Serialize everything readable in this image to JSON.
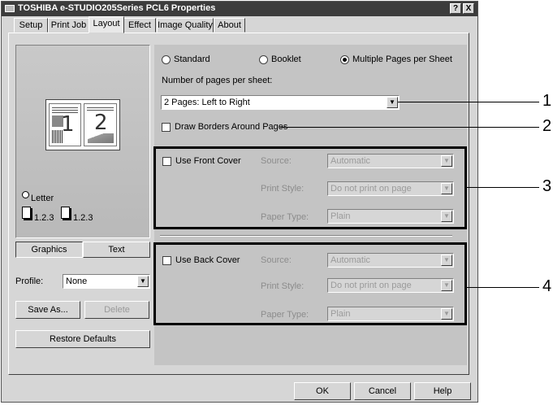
{
  "window": {
    "title": "TOSHIBA e-STUDIO205Series PCL6 Properties",
    "help_button": "?",
    "close_button": "X"
  },
  "tabs": [
    {
      "label": "Setup"
    },
    {
      "label": "Print Job"
    },
    {
      "label": "Layout",
      "selected": true
    },
    {
      "label": "Effect"
    },
    {
      "label": "Image Quality"
    },
    {
      "label": "About"
    }
  ],
  "preview": {
    "page_numbers": [
      "1",
      "2"
    ],
    "paper_label": "Letter",
    "collate_1": "1.2.3",
    "collate_2": "1.2.3"
  },
  "left_tabs": {
    "graphics": "Graphics",
    "text": "Text"
  },
  "profile": {
    "label": "Profile:",
    "value": "None"
  },
  "buttons": {
    "save_as": "Save As...",
    "delete": "Delete",
    "restore": "Restore Defaults",
    "ok": "OK",
    "cancel": "Cancel",
    "help": "Help"
  },
  "layout_mode": {
    "options": [
      "Standard",
      "Booklet",
      "Multiple Pages per Sheet"
    ],
    "selected": "Multiple Pages per Sheet"
  },
  "pages_per_sheet": {
    "label": "Number of pages per sheet:",
    "value": "2 Pages: Left to Right"
  },
  "draw_borders": {
    "label": "Draw Borders Around Pages",
    "checked": false
  },
  "front_cover": {
    "label": "Use Front Cover",
    "checked": false,
    "source_label": "Source:",
    "source_value": "Automatic",
    "print_style_label": "Print Style:",
    "print_style_value": "Do not print on page",
    "paper_type_label": "Paper Type:",
    "paper_type_value": "Plain"
  },
  "back_cover": {
    "label": "Use Back Cover",
    "checked": false,
    "source_label": "Source:",
    "source_value": "Automatic",
    "print_style_label": "Print Style:",
    "print_style_value": "Do not print on page",
    "paper_type_label": "Paper Type:",
    "paper_type_value": "Plain"
  },
  "callouts": [
    "1",
    "2",
    "3",
    "4"
  ]
}
